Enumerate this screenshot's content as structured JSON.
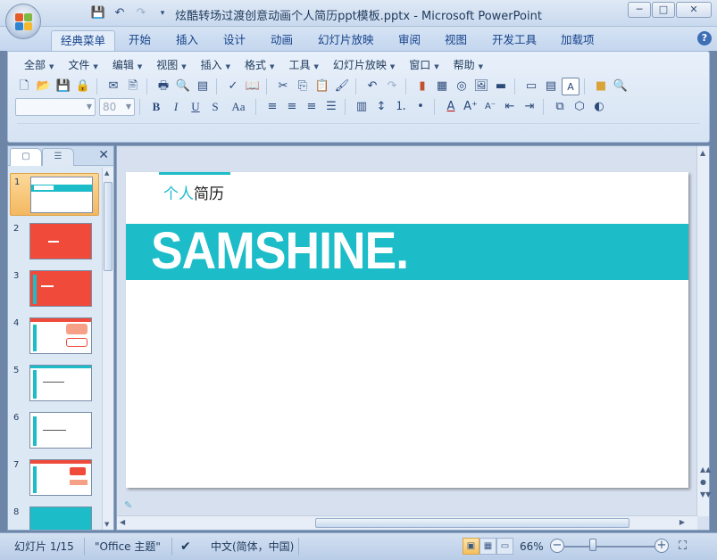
{
  "window": {
    "title": "炫酷转场过渡创意动画个人简历ppt模板.pptx - Microsoft PowerPoint",
    "minimize": "─",
    "maximize": "□",
    "close": "✕"
  },
  "quick_access": [
    "save-icon",
    "undo-icon",
    "redo-icon",
    "customize-icon"
  ],
  "ribbon_tabs": [
    {
      "label": "经典菜单",
      "active": true
    },
    {
      "label": "开始"
    },
    {
      "label": "插入"
    },
    {
      "label": "设计"
    },
    {
      "label": "动画"
    },
    {
      "label": "幻灯片放映"
    },
    {
      "label": "审阅"
    },
    {
      "label": "视图"
    },
    {
      "label": "开发工具"
    },
    {
      "label": "加载项"
    }
  ],
  "help": "?",
  "menus": [
    "全部",
    "文件",
    "编辑",
    "视图",
    "插入",
    "格式",
    "工具",
    "幻灯片放映",
    "窗口",
    "帮助"
  ],
  "font": {
    "name": "",
    "size": "80"
  },
  "format_buttons": {
    "bold": "B",
    "italic": "I",
    "underline": "U",
    "shadow": "S",
    "case": "Aa"
  },
  "slide_pane": {
    "thumbnails": [
      {
        "num": "1",
        "selected": true
      },
      {
        "num": "2"
      },
      {
        "num": "3"
      },
      {
        "num": "4"
      },
      {
        "num": "5"
      },
      {
        "num": "6"
      },
      {
        "num": "7"
      },
      {
        "num": "8"
      }
    ]
  },
  "slide": {
    "subtitle_accent": "个人",
    "subtitle_rest": "简历",
    "name": "SAMSHINE.",
    "accent_color": "#1cbcc8"
  },
  "statusbar": {
    "slide_info": "幻灯片 1/15",
    "theme": "\"Office 主题\"",
    "language": "中文(简体，中国)",
    "zoom": "66%"
  }
}
